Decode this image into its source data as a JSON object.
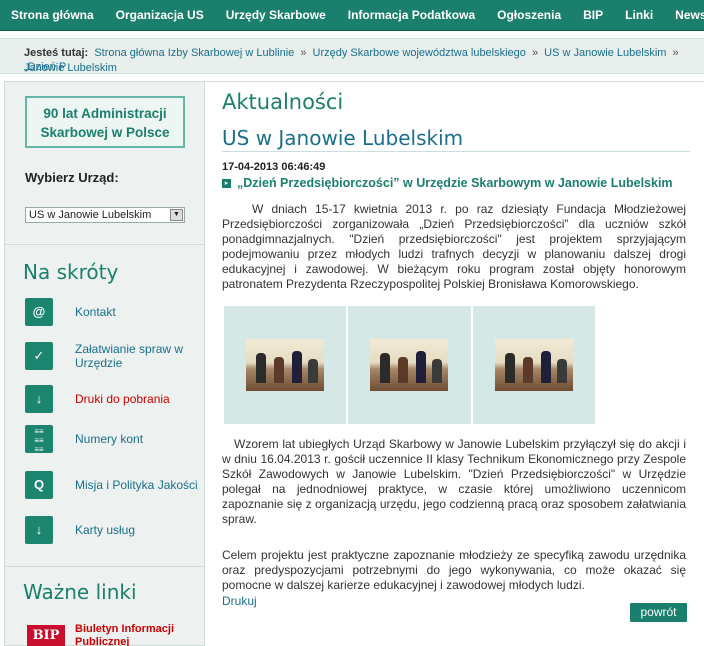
{
  "nav": [
    "Strona główna",
    "Organizacja US",
    "Urzędy Skarbowe",
    "Informacja Podatkowa",
    "Ogłoszenia",
    "BIP",
    "Linki",
    "Newsl"
  ],
  "breadcrumb": {
    "label": "Jesteś tutaj:",
    "items": [
      "Strona główna Izby Skarbowej w Lublinie",
      "Urzędy Skarbowe województwa lubelskiego",
      "US w Janowie Lubelskim",
      "„Dzień P"
    ],
    "line2": "Janowie Lubelskim"
  },
  "sidebar": {
    "anniversary_line1": "90 lat Administracji",
    "anniversary_line2": "Skarbowej w Polsce",
    "pick_label": "Wybierz Urząd:",
    "selected_office": "US w Janowie Lubelskim",
    "shortcuts_title": "Na skróty",
    "shortcuts": [
      {
        "label": "Kontakt",
        "icon": "mail-icon"
      },
      {
        "label": "Załatwianie spraw w Urzędzie",
        "icon": "check-icon"
      },
      {
        "label": "Druki do pobrania",
        "icon": "download-icon"
      },
      {
        "label": "Numery kont",
        "icon": "account-numbers-icon"
      },
      {
        "label": "Misja i Polityka Jakości",
        "icon": "quality-q-icon"
      },
      {
        "label": "Karty usług",
        "icon": "service-card-icon"
      }
    ],
    "links_title": "Ważne linki",
    "bip_logo": "BIP",
    "bip_label_line1": "Biuletyn Informacji",
    "bip_label_line2": "Publicznej"
  },
  "main": {
    "section_title": "Aktualności",
    "office_title": "US w Janowie Lubelskim",
    "date": "17-04-2013 06:46:49",
    "headline": "„Dzień Przedsiębiorczości” w Urzędzie Skarbowym w Janowie Lubelskim",
    "paragraph1": "W dniach 15-17 kwietnia 2013 r. po raz dziesiąty Fundacja Młodzieżowej Przedsiębiorczości zorganizowała „Dzień Przedsiębiorczości” dla uczniów szkół ponadgimnazjalnych. \"Dzień przedsiębiorczości\" jest projektem sprzyjającym podejmowaniu przez młodych ludzi trafnych decyzji w planowaniu dalszej drogi edukacyjnej i zawodowej. W bieżącym roku program został objęty honorowym patronatem Prezydenta Rzeczypospolitej Polskiej  Bronisława Komorowskiego.",
    "paragraph2": "Wzorem lat ubiegłych Urząd Skarbowy w Janowie Lubelskim przyłączył się do akcji i w dniu 16.04.2013 r. gościł uczennice II klasy Technikum Ekonomicznego przy Zespole Szkół Zawodowych w Janowie Lubelskim. \"Dzień Przedsiębiorczości\" w Urzędzie polegał na jednodniowej praktyce, w czasie której umożliwiono uczennicom zapoznanie się z organizacją urzędu, jego codzienną pracą oraz sposobem załatwiania spraw.",
    "paragraph3": "Celem projektu jest praktyczne zapoznanie młodzieży ze specyfiką zawodu urzędnika oraz predyspozycjami potrzebnymi do jego wykonywania, co może okazać się pomocne w dalszej karierze edukacyjnej i zawodowej młodych ludzi.",
    "print_label": "Drukuj",
    "back_label": "powrót"
  },
  "colors": {
    "brand": "#1a7f6d",
    "link": "#1a6f8c",
    "highlight": "#cc0000"
  }
}
